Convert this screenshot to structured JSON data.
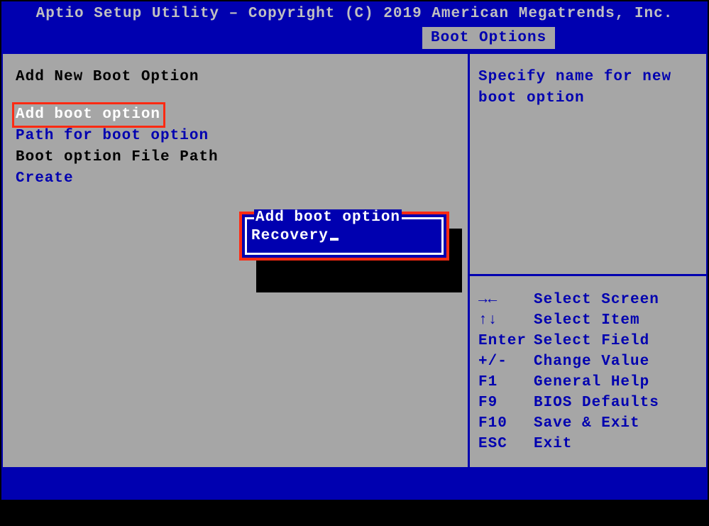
{
  "header": {
    "title": "Aptio Setup Utility – Copyright (C) 2019 American Megatrends, Inc.",
    "tab": "Boot Options"
  },
  "menu": {
    "heading": "Add New Boot Option",
    "selected": "Add boot option",
    "path_label": "Path for boot option",
    "file_path_label": "Boot option File Path",
    "create_label": "Create"
  },
  "popup": {
    "title": "Add boot option",
    "value": "Recovery"
  },
  "help": {
    "line1": "Specify name for new",
    "line2": "boot option"
  },
  "keys": [
    {
      "key": "→←",
      "action": "Select Screen"
    },
    {
      "key": "↑↓",
      "action": "Select Item"
    },
    {
      "key": "Enter",
      "action": "Select Field"
    },
    {
      "key": "+/-",
      "action": "Change Value"
    },
    {
      "key": "F1",
      "action": "General Help"
    },
    {
      "key": "F9",
      "action": "BIOS Defaults"
    },
    {
      "key": "F10",
      "action": "Save & Exit"
    },
    {
      "key": "ESC",
      "action": "Exit"
    }
  ]
}
